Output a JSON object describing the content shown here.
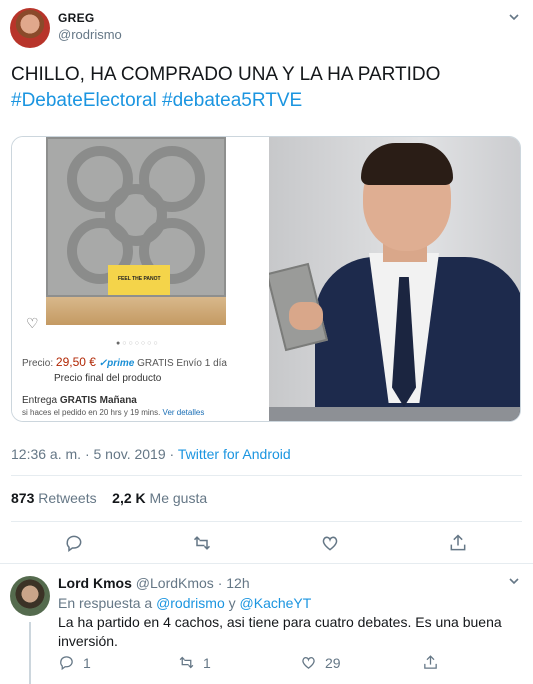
{
  "tweet": {
    "author_name": "GREG",
    "author_handle": "@rodrismo",
    "text_line1": "CHILLO, HA COMPRADO UNA Y LA HA PARTIDO",
    "hashtag1": "#DebateElectoral",
    "hashtag2": "#debatea5RTVE",
    "time": "12:36 a. m.",
    "date": "5 nov. 2019",
    "separator": "·",
    "source": "Twitter for Android",
    "retweets_count": "873",
    "retweets_label": "Retweets",
    "likes_count": "2,2 K",
    "likes_label": "Me gusta"
  },
  "media": {
    "product_card_label": "FEEL THE PANOT",
    "price_label": "Precio:",
    "price_value": "29,50 €",
    "prime_label": "✓prime",
    "shipping": "GRATIS Envío 1 día",
    "final_price": "Precio final del producto",
    "delivery_prefix": "Entrega",
    "delivery_free": "GRATIS",
    "delivery_day": "Mañana",
    "order_note": "si haces el pedido en 20 hrs y 19 mins.",
    "details_link": "Ver detalles"
  },
  "reply": {
    "author_name": "Lord Kmos",
    "author_handle": "@LordKmos",
    "separator": "·",
    "age": "12h",
    "in_reply_prefix": "En respuesta a",
    "mention1": "@rodrismo",
    "and_word": "y",
    "mention2": "@KacheYT",
    "text": "La ha partido en 4 cachos, asi tiene para cuatro debates. Es una buena inversión.",
    "reply_count": "1",
    "retweet_count": "1",
    "like_count": "29"
  },
  "icons": {
    "reply": "reply-icon",
    "retweet": "retweet-icon",
    "like": "heart-icon",
    "share": "share-icon",
    "more": "chevron-down-icon"
  },
  "colors": {
    "link": "#1b95e0",
    "muted": "#657786",
    "text": "#14171a",
    "divider": "#e6ecf0"
  }
}
